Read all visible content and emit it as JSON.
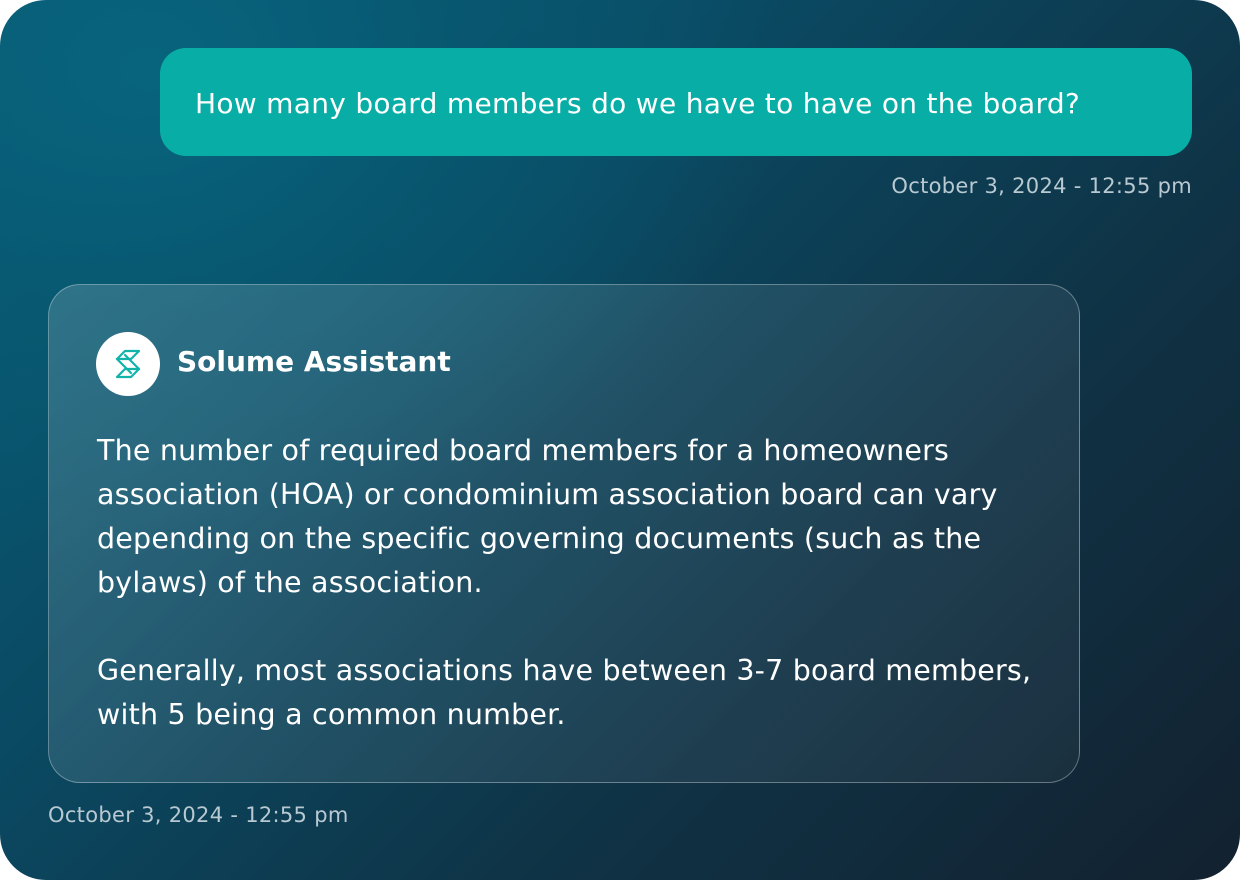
{
  "conversation": {
    "user_message": {
      "text": "How many board members do we have to have on the board?",
      "timestamp": "October 3, 2024 - 12:55 pm"
    },
    "assistant_message": {
      "sender": "Solume Assistant",
      "avatar_icon": "solume-logo-icon",
      "paragraphs": [
        "The number of required board members for a homeowners association (HOA) or condominium association board can vary depending on the specific governing documents (such as the bylaws) of the association.",
        "Generally, most associations have between 3-7 board members, with 5 being a common number."
      ],
      "timestamp": "October 3, 2024 - 12:55 pm"
    }
  },
  "colors": {
    "background_start": "#07607a",
    "background_end": "#13212f",
    "user_bubble": "#08aea6",
    "logo_accent": "#12b3a8",
    "timestamp_text": "#b8c9d1"
  }
}
